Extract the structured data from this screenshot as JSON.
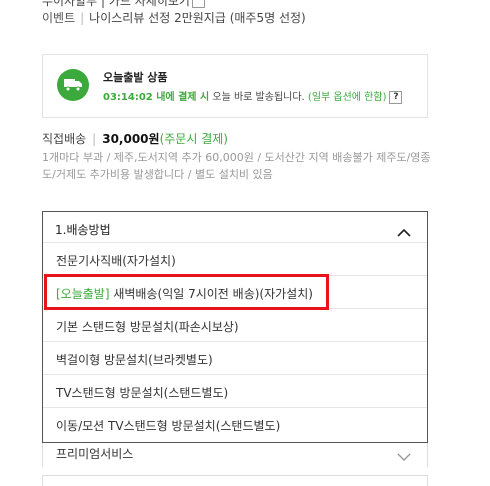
{
  "top_cut": {
    "text": "무이자할부 | 카드 자세히보기"
  },
  "event": {
    "label": "이벤트",
    "text": "나이스리뷰 선정 2만원지급 (매주5명 선정)"
  },
  "today_delivery": {
    "title": "오늘출발 상품",
    "deadline": "03:14:02 내에 결제 시",
    "desc": "오늘 바로 발송됩니다.",
    "exception": "(일부 옵션에 한함)",
    "help": "?"
  },
  "shipping": {
    "label": "직접배송",
    "price": "30,000원",
    "note_green": "(주문시 결제)",
    "note": "1개마다 부과 / 제주,도서지역 추가 60,000원 / 도서산간 지역 배송불가 제주도/영종도/거제도 추가비용 발생합니다 / 별도 설치비 있음"
  },
  "dropdown": {
    "title": "1.배송방법",
    "items": [
      {
        "tag": "",
        "label": "전문기사직배(자가설치)"
      },
      {
        "tag": "[오늘출발]",
        "label": " 새벽배송(익일 7시이전 배송)(자가설치)"
      },
      {
        "tag": "",
        "label": "기본 스탠드형 방문설치(파손시보상)"
      },
      {
        "tag": "",
        "label": "벽걸이형 방문설치(브라켓별도)"
      },
      {
        "tag": "",
        "label": "TV스탠드형 방문설치(스탠드별도)"
      },
      {
        "tag": "",
        "label": "이동/모션 TV스탠드형 방문설치(스탠드별도)"
      }
    ]
  },
  "premium": {
    "label": "프리미엄서비스"
  },
  "colors": {
    "accent_green": "#3ba93b",
    "highlight_red": "#e8141c"
  }
}
